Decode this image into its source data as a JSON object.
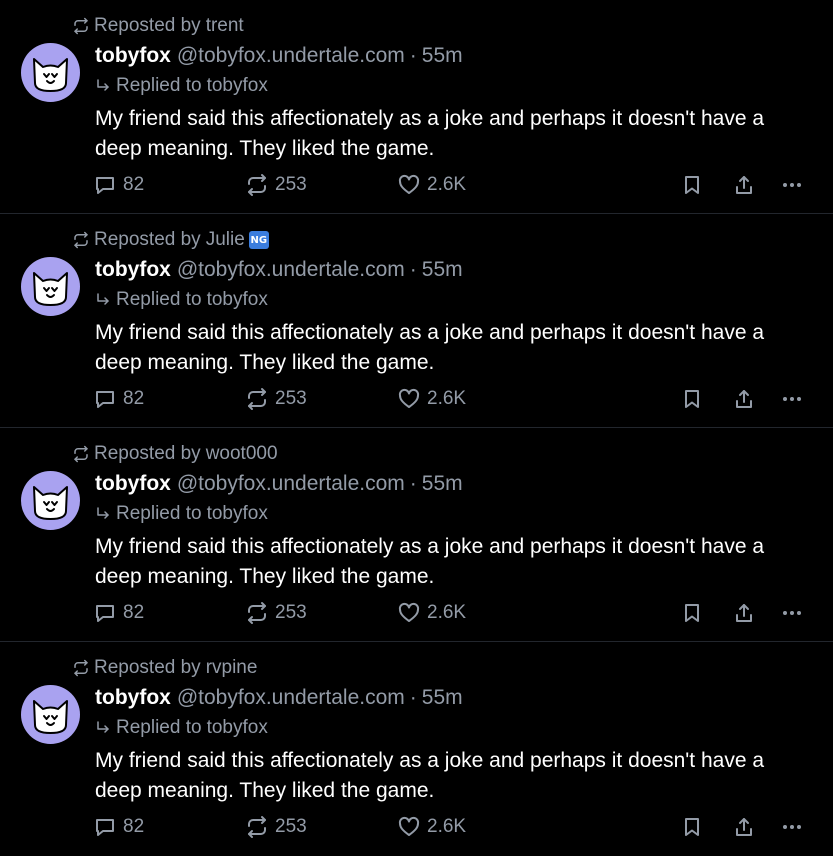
{
  "posts": [
    {
      "repost_prefix": "Reposted by",
      "reposted_by": "trent",
      "badge": "",
      "author_name": "tobyfox",
      "author_handle": "@tobyfox.undertale.com",
      "separator": "·",
      "time": "55m",
      "reply_prefix": "Replied to",
      "replied_to": "tobyfox",
      "text": "My friend said this affectionately as a joke and perhaps it doesn't have a deep meaning. They liked the game.",
      "reply_count": "82",
      "repost_count": "253",
      "like_count": "2.6K"
    },
    {
      "repost_prefix": "Reposted by",
      "reposted_by": "Julie",
      "badge": "NG",
      "author_name": "tobyfox",
      "author_handle": "@tobyfox.undertale.com",
      "separator": "·",
      "time": "55m",
      "reply_prefix": "Replied to",
      "replied_to": "tobyfox",
      "text": "My friend said this affectionately as a joke and perhaps it doesn't have a deep meaning. They liked the game.",
      "reply_count": "82",
      "repost_count": "253",
      "like_count": "2.6K"
    },
    {
      "repost_prefix": "Reposted by",
      "reposted_by": "woot000",
      "badge": "",
      "author_name": "tobyfox",
      "author_handle": "@tobyfox.undertale.com",
      "separator": "·",
      "time": "55m",
      "reply_prefix": "Replied to",
      "replied_to": "tobyfox",
      "text": "My friend said this affectionately as a joke and perhaps it doesn't have a deep meaning. They liked the game.",
      "reply_count": "82",
      "repost_count": "253",
      "like_count": "2.6K"
    },
    {
      "repost_prefix": "Reposted by",
      "reposted_by": "rvpine",
      "badge": "",
      "author_name": "tobyfox",
      "author_handle": "@tobyfox.undertale.com",
      "separator": "·",
      "time": "55m",
      "reply_prefix": "Replied to",
      "replied_to": "tobyfox",
      "text": "My friend said this affectionately as a joke and perhaps it doesn't have a deep meaning. They liked the game.",
      "reply_count": "82",
      "repost_count": "253",
      "like_count": "2.6K"
    }
  ],
  "icons": {
    "repost": "repost-icon",
    "reply_arrow": "reply-arrow-icon",
    "comment": "comment-icon",
    "like": "heart-icon",
    "bookmark": "bookmark-icon",
    "share": "share-icon",
    "more": "more-icon",
    "avatar": "cat-avatar"
  },
  "colors": {
    "background": "#000000",
    "text": "#ffffff",
    "muted": "#939ba7",
    "divider": "#22262d",
    "avatar_bg": "#a9a2f0",
    "badge": "#3b7ddd"
  }
}
